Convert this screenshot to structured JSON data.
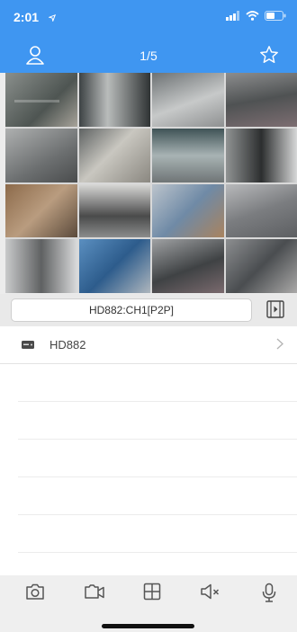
{
  "status_bar": {
    "time": "2:01",
    "location_icon": "location-arrow-icon",
    "signal_icon": "cellular-signal-icon",
    "wifi_icon": "wifi-icon",
    "battery_icon": "battery-icon"
  },
  "header": {
    "page_indicator": "1/5",
    "left_icon": "user-icon",
    "right_icon": "star-icon"
  },
  "channel_bar": {
    "current_channel": "HD882:CH1[P2P]",
    "playback_icon": "film-playback-icon"
  },
  "devices": [
    {
      "name": "HD882",
      "icon": "dvr-device-icon"
    }
  ],
  "toolbar": [
    {
      "icon": "camera-snapshot-icon"
    },
    {
      "icon": "video-record-icon"
    },
    {
      "icon": "grid-layout-icon"
    },
    {
      "icon": "mute-speaker-icon"
    },
    {
      "icon": "microphone-icon"
    }
  ],
  "colors": {
    "header": "#3f96f1",
    "toolbar_icon": "#555555"
  }
}
